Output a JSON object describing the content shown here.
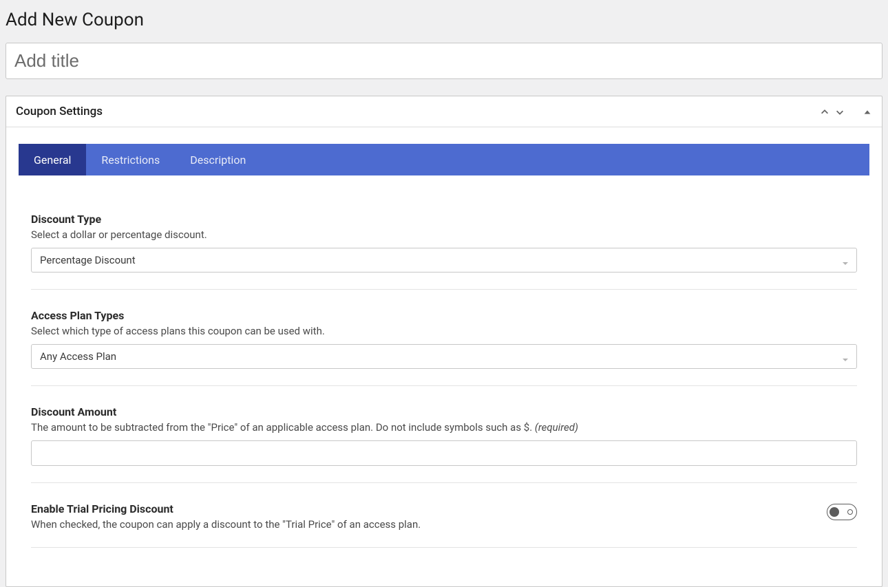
{
  "page": {
    "title": "Add New Coupon",
    "title_input_placeholder": "Add title",
    "title_input_value": ""
  },
  "panel": {
    "title": "Coupon Settings"
  },
  "tabs": [
    {
      "label": "General",
      "active": true
    },
    {
      "label": "Restrictions",
      "active": false
    },
    {
      "label": "Description",
      "active": false
    }
  ],
  "fields": {
    "discount_type": {
      "label": "Discount Type",
      "description": "Select a dollar or percentage discount.",
      "selected": "Percentage Discount"
    },
    "access_plan_types": {
      "label": "Access Plan Types",
      "description": "Select which type of access plans this coupon can be used with.",
      "selected": "Any Access Plan"
    },
    "discount_amount": {
      "label": "Discount Amount",
      "description": "The amount to be subtracted from the \"Price\" of an applicable access plan. Do not include symbols such as $. ",
      "required_text": "(required)",
      "value": ""
    },
    "trial_pricing": {
      "label": "Enable Trial Pricing Discount",
      "description": "When checked, the coupon can apply a discount to the \"Trial Price\" of an access plan.",
      "enabled": false
    }
  }
}
